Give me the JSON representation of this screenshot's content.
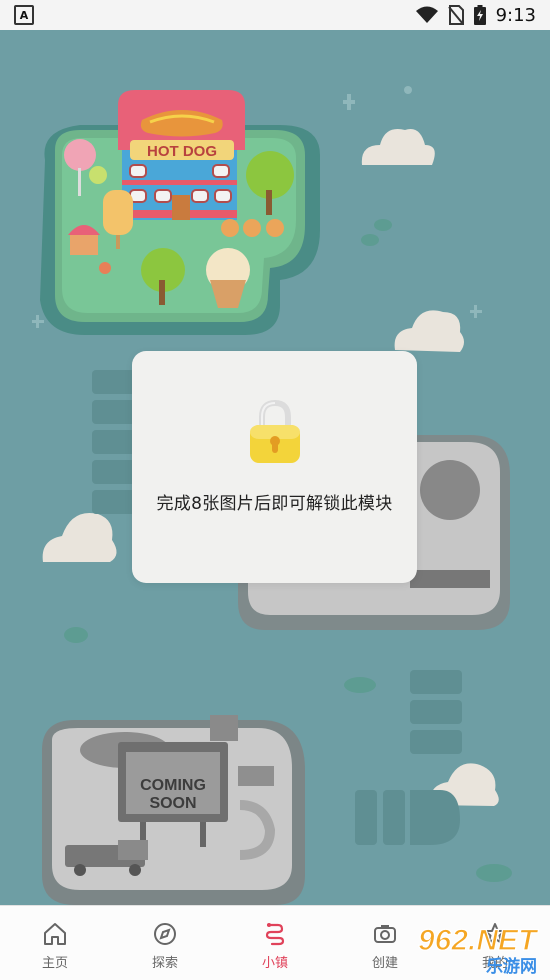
{
  "status_bar": {
    "notification_icon": "A",
    "time": "9:13",
    "icons": [
      "wifi-icon",
      "no-sim-icon",
      "battery-charging-icon"
    ]
  },
  "map": {
    "hotdog_sign": "HOT DOG",
    "coming_soon_sign_line1": "COMING",
    "coming_soon_sign_line2": "SOON"
  },
  "modal": {
    "message": "完成8张图片后即可解锁此模块",
    "icon": "padlock-icon"
  },
  "tabbar": {
    "tabs": [
      {
        "label": "主页",
        "icon": "home-icon"
      },
      {
        "label": "探索",
        "icon": "compass-icon"
      },
      {
        "label": "小镇",
        "icon": "town-icon"
      },
      {
        "label": "创建",
        "icon": "camera-icon"
      },
      {
        "label": "我的",
        "icon": "star-icon"
      }
    ],
    "active_index": 2,
    "active_color": "#e0425a"
  },
  "watermark": {
    "line1": "962.NET",
    "line2": "乐游网"
  }
}
